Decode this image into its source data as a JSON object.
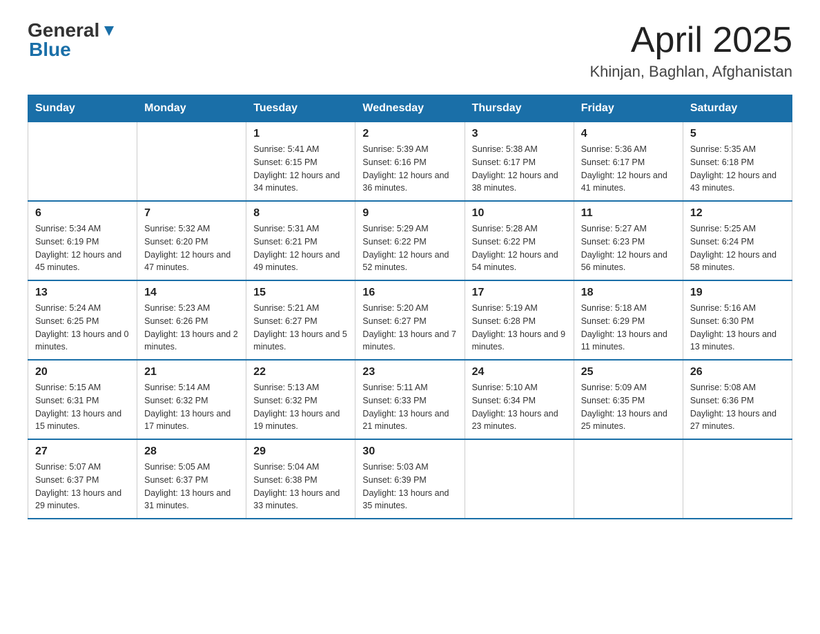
{
  "header": {
    "logo_general": "General",
    "logo_blue": "Blue",
    "title": "April 2025",
    "subtitle": "Khinjan, Baghlan, Afghanistan"
  },
  "weekdays": [
    "Sunday",
    "Monday",
    "Tuesday",
    "Wednesday",
    "Thursday",
    "Friday",
    "Saturday"
  ],
  "weeks": [
    [
      {
        "day": "",
        "sunrise": "",
        "sunset": "",
        "daylight": ""
      },
      {
        "day": "",
        "sunrise": "",
        "sunset": "",
        "daylight": ""
      },
      {
        "day": "1",
        "sunrise": "Sunrise: 5:41 AM",
        "sunset": "Sunset: 6:15 PM",
        "daylight": "Daylight: 12 hours and 34 minutes."
      },
      {
        "day": "2",
        "sunrise": "Sunrise: 5:39 AM",
        "sunset": "Sunset: 6:16 PM",
        "daylight": "Daylight: 12 hours and 36 minutes."
      },
      {
        "day": "3",
        "sunrise": "Sunrise: 5:38 AM",
        "sunset": "Sunset: 6:17 PM",
        "daylight": "Daylight: 12 hours and 38 minutes."
      },
      {
        "day": "4",
        "sunrise": "Sunrise: 5:36 AM",
        "sunset": "Sunset: 6:17 PM",
        "daylight": "Daylight: 12 hours and 41 minutes."
      },
      {
        "day": "5",
        "sunrise": "Sunrise: 5:35 AM",
        "sunset": "Sunset: 6:18 PM",
        "daylight": "Daylight: 12 hours and 43 minutes."
      }
    ],
    [
      {
        "day": "6",
        "sunrise": "Sunrise: 5:34 AM",
        "sunset": "Sunset: 6:19 PM",
        "daylight": "Daylight: 12 hours and 45 minutes."
      },
      {
        "day": "7",
        "sunrise": "Sunrise: 5:32 AM",
        "sunset": "Sunset: 6:20 PM",
        "daylight": "Daylight: 12 hours and 47 minutes."
      },
      {
        "day": "8",
        "sunrise": "Sunrise: 5:31 AM",
        "sunset": "Sunset: 6:21 PM",
        "daylight": "Daylight: 12 hours and 49 minutes."
      },
      {
        "day": "9",
        "sunrise": "Sunrise: 5:29 AM",
        "sunset": "Sunset: 6:22 PM",
        "daylight": "Daylight: 12 hours and 52 minutes."
      },
      {
        "day": "10",
        "sunrise": "Sunrise: 5:28 AM",
        "sunset": "Sunset: 6:22 PM",
        "daylight": "Daylight: 12 hours and 54 minutes."
      },
      {
        "day": "11",
        "sunrise": "Sunrise: 5:27 AM",
        "sunset": "Sunset: 6:23 PM",
        "daylight": "Daylight: 12 hours and 56 minutes."
      },
      {
        "day": "12",
        "sunrise": "Sunrise: 5:25 AM",
        "sunset": "Sunset: 6:24 PM",
        "daylight": "Daylight: 12 hours and 58 minutes."
      }
    ],
    [
      {
        "day": "13",
        "sunrise": "Sunrise: 5:24 AM",
        "sunset": "Sunset: 6:25 PM",
        "daylight": "Daylight: 13 hours and 0 minutes."
      },
      {
        "day": "14",
        "sunrise": "Sunrise: 5:23 AM",
        "sunset": "Sunset: 6:26 PM",
        "daylight": "Daylight: 13 hours and 2 minutes."
      },
      {
        "day": "15",
        "sunrise": "Sunrise: 5:21 AM",
        "sunset": "Sunset: 6:27 PM",
        "daylight": "Daylight: 13 hours and 5 minutes."
      },
      {
        "day": "16",
        "sunrise": "Sunrise: 5:20 AM",
        "sunset": "Sunset: 6:27 PM",
        "daylight": "Daylight: 13 hours and 7 minutes."
      },
      {
        "day": "17",
        "sunrise": "Sunrise: 5:19 AM",
        "sunset": "Sunset: 6:28 PM",
        "daylight": "Daylight: 13 hours and 9 minutes."
      },
      {
        "day": "18",
        "sunrise": "Sunrise: 5:18 AM",
        "sunset": "Sunset: 6:29 PM",
        "daylight": "Daylight: 13 hours and 11 minutes."
      },
      {
        "day": "19",
        "sunrise": "Sunrise: 5:16 AM",
        "sunset": "Sunset: 6:30 PM",
        "daylight": "Daylight: 13 hours and 13 minutes."
      }
    ],
    [
      {
        "day": "20",
        "sunrise": "Sunrise: 5:15 AM",
        "sunset": "Sunset: 6:31 PM",
        "daylight": "Daylight: 13 hours and 15 minutes."
      },
      {
        "day": "21",
        "sunrise": "Sunrise: 5:14 AM",
        "sunset": "Sunset: 6:32 PM",
        "daylight": "Daylight: 13 hours and 17 minutes."
      },
      {
        "day": "22",
        "sunrise": "Sunrise: 5:13 AM",
        "sunset": "Sunset: 6:32 PM",
        "daylight": "Daylight: 13 hours and 19 minutes."
      },
      {
        "day": "23",
        "sunrise": "Sunrise: 5:11 AM",
        "sunset": "Sunset: 6:33 PM",
        "daylight": "Daylight: 13 hours and 21 minutes."
      },
      {
        "day": "24",
        "sunrise": "Sunrise: 5:10 AM",
        "sunset": "Sunset: 6:34 PM",
        "daylight": "Daylight: 13 hours and 23 minutes."
      },
      {
        "day": "25",
        "sunrise": "Sunrise: 5:09 AM",
        "sunset": "Sunset: 6:35 PM",
        "daylight": "Daylight: 13 hours and 25 minutes."
      },
      {
        "day": "26",
        "sunrise": "Sunrise: 5:08 AM",
        "sunset": "Sunset: 6:36 PM",
        "daylight": "Daylight: 13 hours and 27 minutes."
      }
    ],
    [
      {
        "day": "27",
        "sunrise": "Sunrise: 5:07 AM",
        "sunset": "Sunset: 6:37 PM",
        "daylight": "Daylight: 13 hours and 29 minutes."
      },
      {
        "day": "28",
        "sunrise": "Sunrise: 5:05 AM",
        "sunset": "Sunset: 6:37 PM",
        "daylight": "Daylight: 13 hours and 31 minutes."
      },
      {
        "day": "29",
        "sunrise": "Sunrise: 5:04 AM",
        "sunset": "Sunset: 6:38 PM",
        "daylight": "Daylight: 13 hours and 33 minutes."
      },
      {
        "day": "30",
        "sunrise": "Sunrise: 5:03 AM",
        "sunset": "Sunset: 6:39 PM",
        "daylight": "Daylight: 13 hours and 35 minutes."
      },
      {
        "day": "",
        "sunrise": "",
        "sunset": "",
        "daylight": ""
      },
      {
        "day": "",
        "sunrise": "",
        "sunset": "",
        "daylight": ""
      },
      {
        "day": "",
        "sunrise": "",
        "sunset": "",
        "daylight": ""
      }
    ]
  ]
}
